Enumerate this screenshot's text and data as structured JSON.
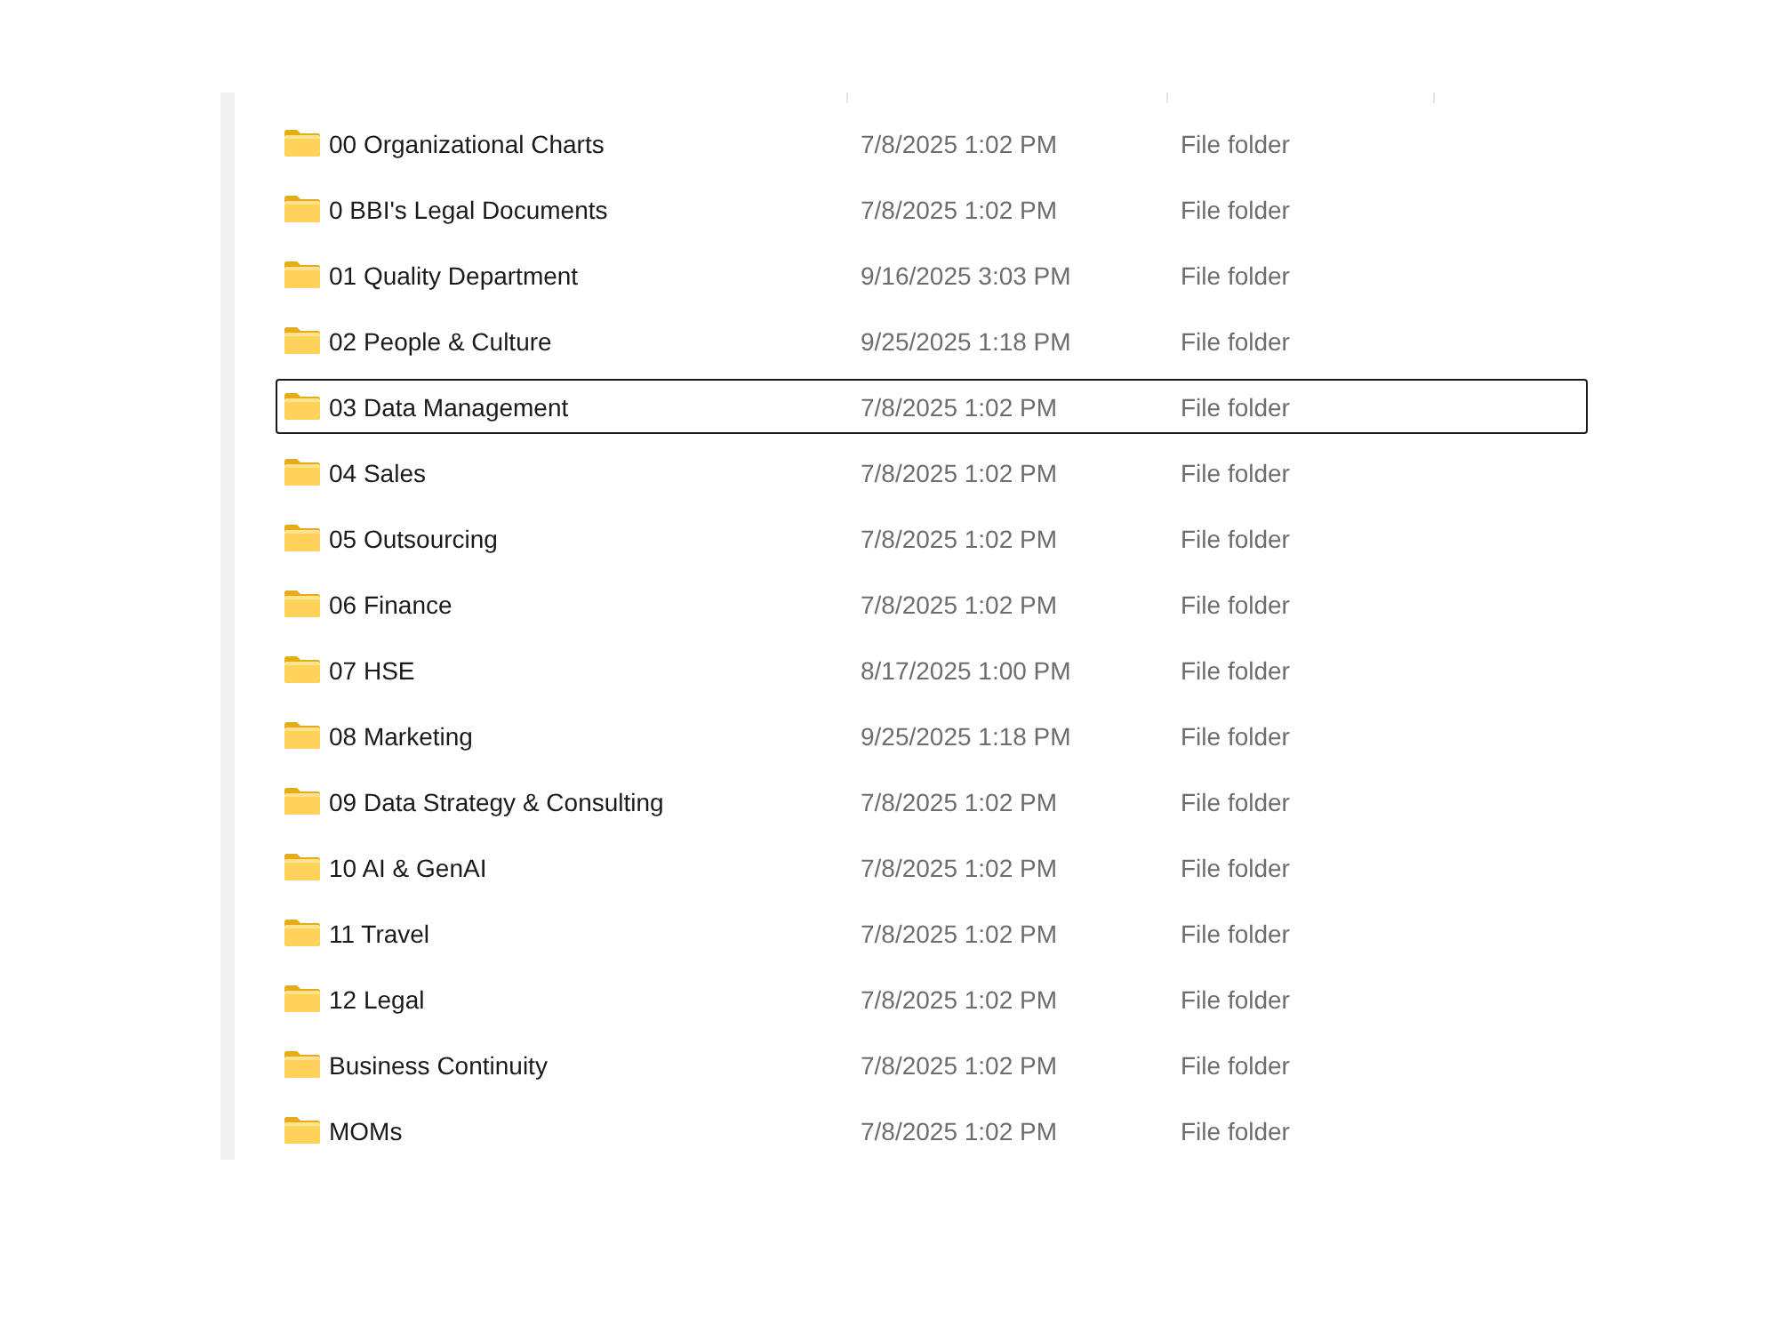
{
  "file_list": {
    "rows": [
      {
        "name": "00 Organizational Charts",
        "datetime": "7/8/2025 1:02 PM",
        "type": "File folder",
        "focused": false
      },
      {
        "name": "0 BBI's Legal Documents",
        "datetime": "7/8/2025 1:02 PM",
        "type": "File folder",
        "focused": false
      },
      {
        "name": "01 Quality Department",
        "datetime": "9/16/2025 3:03 PM",
        "type": "File folder",
        "focused": false
      },
      {
        "name": "02 People & Culture",
        "datetime": "9/25/2025 1:18 PM",
        "type": "File folder",
        "focused": false
      },
      {
        "name": "03 Data Management",
        "datetime": "7/8/2025 1:02 PM",
        "type": "File folder",
        "focused": true
      },
      {
        "name": "04 Sales",
        "datetime": "7/8/2025 1:02 PM",
        "type": "File folder",
        "focused": false
      },
      {
        "name": "05 Outsourcing",
        "datetime": "7/8/2025 1:02 PM",
        "type": "File folder",
        "focused": false
      },
      {
        "name": "06 Finance",
        "datetime": "7/8/2025 1:02 PM",
        "type": "File folder",
        "focused": false
      },
      {
        "name": "07 HSE",
        "datetime": "8/17/2025 1:00 PM",
        "type": "File folder",
        "focused": false
      },
      {
        "name": "08 Marketing",
        "datetime": "9/25/2025 1:18 PM",
        "type": "File folder",
        "focused": false
      },
      {
        "name": "09 Data Strategy & Consulting",
        "datetime": "7/8/2025 1:02 PM",
        "type": "File folder",
        "focused": false
      },
      {
        "name": "10 AI & GenAI",
        "datetime": "7/8/2025 1:02 PM",
        "type": "File folder",
        "focused": false
      },
      {
        "name": "11 Travel",
        "datetime": "7/8/2025 1:02 PM",
        "type": "File folder",
        "focused": false
      },
      {
        "name": "12 Legal",
        "datetime": "7/8/2025 1:02 PM",
        "type": "File folder",
        "focused": false
      },
      {
        "name": "Business Continuity",
        "datetime": "7/8/2025 1:02 PM",
        "type": "File folder",
        "focused": false
      },
      {
        "name": "MOMs",
        "datetime": "7/8/2025 1:02 PM",
        "type": "File folder",
        "focused": false
      }
    ]
  }
}
